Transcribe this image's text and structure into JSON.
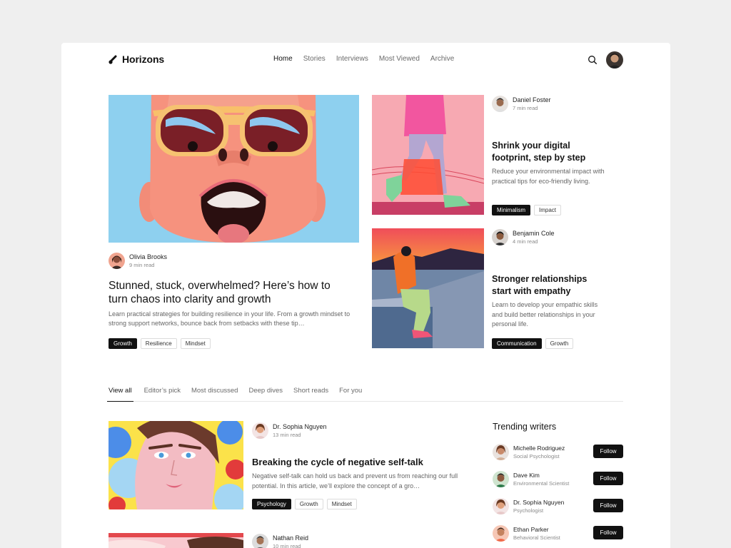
{
  "brand": {
    "name": "Horizons"
  },
  "nav": {
    "items": [
      {
        "label": "Home",
        "active": true
      },
      {
        "label": "Stories"
      },
      {
        "label": "Interviews"
      },
      {
        "label": "Most Viewed"
      },
      {
        "label": "Archive"
      }
    ]
  },
  "header": {
    "search_icon": "search-icon",
    "avatar": "user-avatar"
  },
  "featured": {
    "main": {
      "author": "Olivia Brooks",
      "read_time": "9 min read",
      "title": "Stunned, stuck, overwhelmed? Here’s how to turn chaos into clarity and growth",
      "description": "Learn practical strategies for building resilience in your life. From a growth mindset to strong support networks, bounce back from setbacks with these tip…",
      "tags": [
        "Growth",
        "Resilience",
        "Mindset"
      ]
    },
    "side": [
      {
        "author": "Daniel Foster",
        "read_time": "7 min read",
        "title": "Shrink your digital footprint, step by step",
        "description": "Reduce your environmental impact with practical tips for eco-friendly living.",
        "tags": [
          "Minimalism",
          "Impact"
        ]
      },
      {
        "author": "Benjamin Cole",
        "read_time": "4 min read",
        "title": "Stronger relationships start with empathy",
        "description": "Learn to develop your empathic skills and build better relationships in your personal life.",
        "tags": [
          "Communication",
          "Growth"
        ]
      }
    ]
  },
  "tabs": [
    {
      "label": "View all",
      "active": true
    },
    {
      "label": "Editor’s pick"
    },
    {
      "label": "Most discussed"
    },
    {
      "label": "Deep dives"
    },
    {
      "label": "Short reads"
    },
    {
      "label": "For you"
    }
  ],
  "articles": [
    {
      "author": "Dr. Sophia Nguyen",
      "read_time": "13 min read",
      "title": "Breaking the cycle of negative self-talk",
      "description": "Negative self-talk can hold us back and prevent us from reaching our full potential. In this article, we’ll explore the concept of a gro…",
      "tags": [
        "Psychology",
        "Growth",
        "Mindset"
      ]
    },
    {
      "author": "Nathan Reid",
      "read_time": "10 min read"
    }
  ],
  "trending": {
    "title": "Trending writers",
    "follow_label": "Follow",
    "writers": [
      {
        "name": "Michelle Rodriguez",
        "role": "Social Psychologist"
      },
      {
        "name": "Dave Kim",
        "role": "Environmental Scientist"
      },
      {
        "name": "Dr. Sophia Nguyen",
        "role": "Psychologist"
      },
      {
        "name": "Ethan Parker",
        "role": "Behavioral Scientist"
      }
    ]
  },
  "colors": {
    "accent": "#111111",
    "page_bg": "#efefef",
    "card_bg": "#ffffff",
    "muted_text": "#666666"
  }
}
